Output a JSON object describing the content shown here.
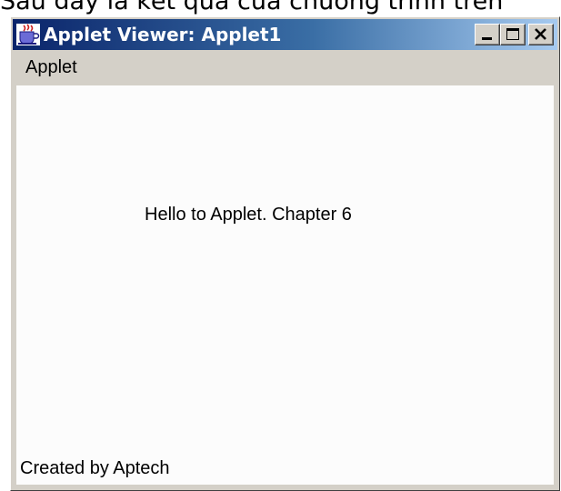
{
  "page": {
    "caption": "Sau đây là kết quả của chương trình trên"
  },
  "window": {
    "title": "Applet Viewer: Applet1",
    "icon": "java-cup-icon",
    "buttons": [
      "minimize",
      "maximize",
      "close"
    ]
  },
  "menubar": {
    "items": [
      {
        "label": "Applet"
      }
    ]
  },
  "applet": {
    "message": "Hello to Applet. Chapter 6",
    "credit": "Created by Aptech"
  },
  "colors": {
    "titlebar_start": "#0a246a",
    "titlebar_end": "#a6caf0",
    "chrome": "#d4d0c8",
    "client": "#fcfcfc"
  }
}
